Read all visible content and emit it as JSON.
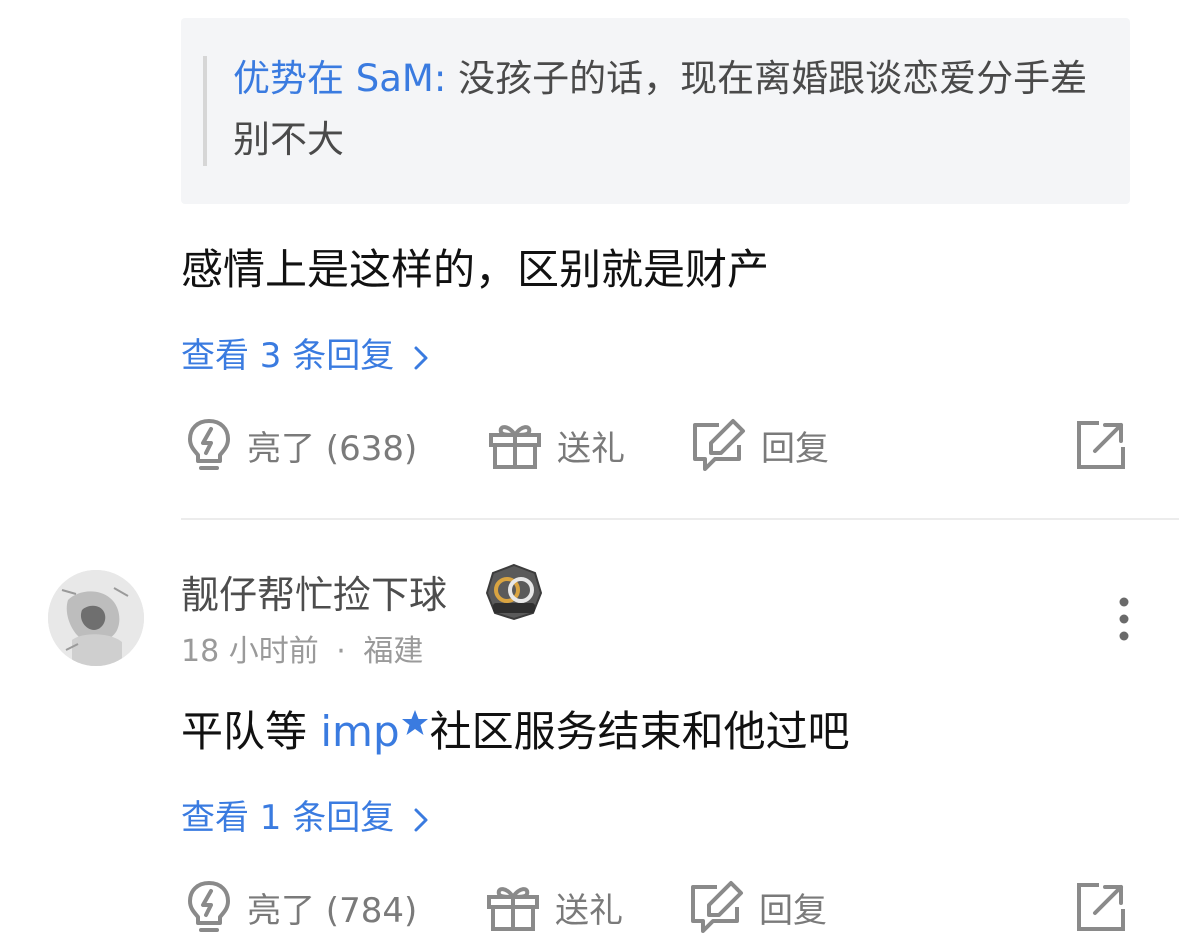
{
  "quoted_comment": {
    "author": "优势在 SaM:",
    "text": " 没孩子的话，现在离婚跟谈恋爱分手差别不大"
  },
  "comment1": {
    "text": "感情上是这样的，区别就是财产",
    "view_replies": "查看 3 条回复",
    "actions": {
      "like": "亮了 (638)",
      "gift": "送礼",
      "reply": "回复"
    }
  },
  "comment2": {
    "username": "靓仔帮忙捡下球",
    "time": "18 小时前",
    "separator": "·",
    "location": "福建",
    "text_before": "平队等 ",
    "mention": "imp",
    "text_after": "社区服务结束和他过吧",
    "view_replies": "查看 1 条回复",
    "actions": {
      "like": "亮了 (784)",
      "gift": "送礼",
      "reply": "回复"
    }
  },
  "colors": {
    "accent": "#3a7be0",
    "icon": "#8a8a8a",
    "quote_bg": "#f4f5f7"
  },
  "icons": [
    "lightbulb-icon",
    "gift-icon",
    "reply-edit-icon",
    "share-icon",
    "chevron-right-icon",
    "more-vertical-icon",
    "star-icon",
    "badge-icon"
  ]
}
